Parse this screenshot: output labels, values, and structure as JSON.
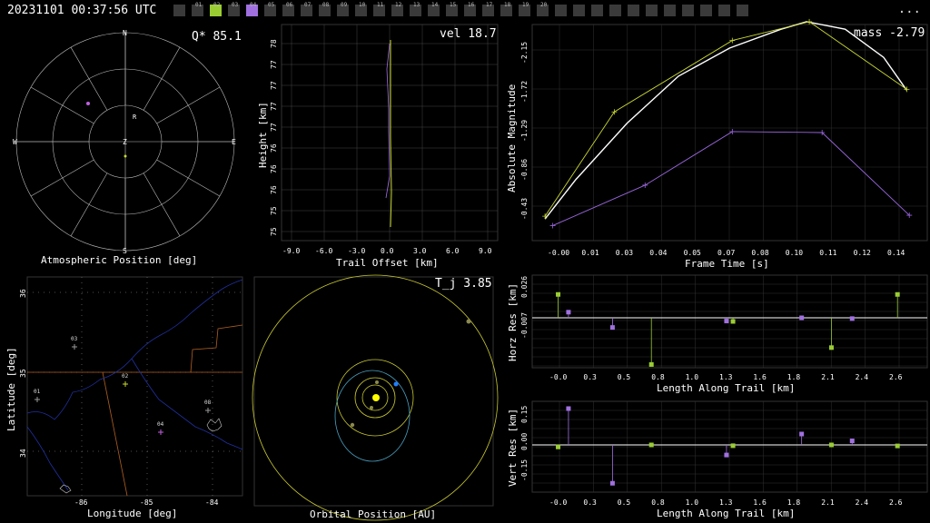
{
  "header": {
    "timestamp": "20231101 00:37:56 UTC",
    "menu": "...",
    "camera_labels": [
      "",
      "01",
      "02",
      "03",
      "04",
      "05",
      "06",
      "07",
      "08",
      "09",
      "10",
      "11",
      "12",
      "13",
      "14",
      "15",
      "16",
      "17",
      "18",
      "19",
      "20",
      "",
      "",
      "",
      "",
      "",
      "",
      "",
      "",
      "",
      "",
      ""
    ],
    "camera_colors": {
      "02": "#9acd32",
      "04": "#a070e0"
    }
  },
  "panels": {
    "polar": {
      "title": "Atmospheric Position [deg]",
      "stat": "Q* 85.1",
      "dirs": {
        "n": "N",
        "s": "S",
        "e": "E",
        "w": "W",
        "z": "Z",
        "r": "R"
      }
    },
    "height": {
      "stat": "vel 18.7",
      "xlabel": "Trail Offset [km]",
      "ylabel": "Height [km]",
      "xticks": [
        "-9.0",
        "-6.0",
        "-3.0",
        "0.0",
        "3.0",
        "6.0",
        "9.0"
      ],
      "yticks": [
        "78",
        "77",
        "77",
        "77",
        "77",
        "76",
        "76",
        "76",
        "75",
        "75"
      ]
    },
    "mag": {
      "stat": "mass -2.79",
      "xlabel": "Frame Time [s]",
      "ylabel": "Absolute Magnitude",
      "xticks": [
        "-0.00",
        "0.01",
        "0.03",
        "0.04",
        "0.05",
        "0.07",
        "0.08",
        "0.10",
        "0.11",
        "0.12",
        "0.14"
      ],
      "yticks": [
        "-2.15",
        "-1.72",
        "-1.29",
        "-0.86",
        "-0.43"
      ]
    },
    "map": {
      "xlabel": "Longitude [deg]",
      "ylabel": "Latitude [deg]",
      "xticks": [
        "-86",
        "-85",
        "-84"
      ],
      "yticks": [
        "36",
        "35",
        "34"
      ],
      "stations": [
        "01",
        "02",
        "03",
        "04",
        "08"
      ]
    },
    "orbit": {
      "stat": "T_j 3.85",
      "xlabel": "Orbital Position [AU]"
    },
    "hres": {
      "xlabel": "Length Along Trail [km]",
      "ylabel": "Horz Res [km]",
      "yticks": [
        "0.026",
        "-0.007"
      ],
      "xticks": [
        "-0.0",
        "0.3",
        "0.5",
        "0.8",
        "1.0",
        "1.3",
        "1.6",
        "1.8",
        "2.1",
        "2.4",
        "2.6"
      ]
    },
    "vres": {
      "xlabel": "Length Along Trail [km]",
      "ylabel": "Vert Res [km]",
      "yticks": [
        "0.15",
        "0.00",
        "-0.15"
      ],
      "xticks": [
        "-0.0",
        "0.3",
        "0.5",
        "0.8",
        "1.0",
        "1.3",
        "1.6",
        "1.8",
        "2.1",
        "2.4",
        "2.6"
      ]
    }
  },
  "chart_data": [
    {
      "type": "line",
      "title": "",
      "xlabel": "Frame Time [s]",
      "ylabel": "Absolute Magnitude",
      "xlim": [
        -0.007,
        0.147
      ],
      "ylim": [
        -0.1,
        -2.4
      ],
      "series": [
        {
          "color": "#ffffff",
          "x": [
            -0.002,
            0.01,
            0.03,
            0.05,
            0.07,
            0.09,
            0.1,
            0.115,
            0.13,
            0.139
          ],
          "y": [
            -0.33,
            -0.75,
            -1.35,
            -1.85,
            -2.15,
            -2.35,
            -2.43,
            -2.35,
            -2.05,
            -1.7
          ]
        },
        {
          "color": "#c8d830",
          "x": [
            -0.002,
            0.025,
            0.071,
            0.101,
            0.139
          ],
          "y": [
            -0.36,
            -1.47,
            -2.23,
            -2.43,
            -1.71
          ]
        },
        {
          "color": "#9966dd",
          "x": [
            0.001,
            0.037,
            0.071,
            0.106,
            0.14
          ],
          "y": [
            -0.26,
            -0.69,
            -1.26,
            -1.25,
            -0.37
          ]
        }
      ]
    },
    {
      "type": "scatter",
      "title": "",
      "xlabel": "Length Along Trail [km]",
      "ylabel": "Horz Res [km]",
      "xlim": [
        -0.2,
        2.85
      ],
      "ylim": [
        -0.075,
        0.04
      ],
      "series": [
        {
          "color": "#9acd32",
          "x": [
            0.0,
            0.72,
            1.35,
            2.11,
            2.62
          ],
          "y": [
            0.029,
            -0.058,
            -0.0045,
            -0.037,
            0.029
          ]
        },
        {
          "color": "#a070e0",
          "x": [
            0.08,
            0.42,
            1.3,
            1.88,
            2.27
          ],
          "y": [
            0.007,
            -0.012,
            -0.004,
            0.0,
            -0.001
          ]
        }
      ]
    },
    {
      "type": "scatter",
      "title": "",
      "xlabel": "Length Along Trail [km]",
      "ylabel": "Vert Res [km]",
      "xlim": [
        -0.2,
        2.85
      ],
      "ylim": [
        -0.24,
        0.21
      ],
      "series": [
        {
          "color": "#9acd32",
          "x": [
            0.0,
            0.72,
            1.35,
            2.11,
            2.62
          ],
          "y": [
            -0.01,
            0.0,
            -0.004,
            0.0,
            -0.005
          ]
        },
        {
          "color": "#a070e0",
          "x": [
            0.08,
            0.42,
            1.3,
            1.88,
            2.27
          ],
          "y": [
            0.18,
            -0.19,
            -0.05,
            0.054,
            0.02
          ]
        }
      ]
    }
  ]
}
